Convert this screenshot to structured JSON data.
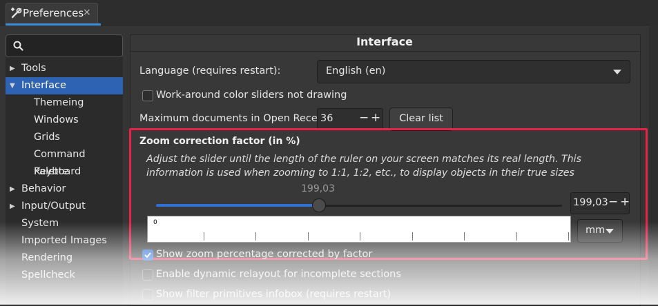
{
  "window": {
    "tab_label": "Preferences",
    "tab_close": "×",
    "tab_icon": "tools-icon"
  },
  "sidebar": {
    "search_placeholder": "",
    "items": [
      {
        "label": "Tools",
        "expandable": true,
        "expanded": false,
        "indent": 0
      },
      {
        "label": "Interface",
        "expandable": true,
        "expanded": true,
        "indent": 0,
        "selected": true
      },
      {
        "label": "Themeing",
        "indent": 1
      },
      {
        "label": "Windows",
        "indent": 1
      },
      {
        "label": "Grids",
        "indent": 1
      },
      {
        "label": "Command Palette",
        "indent": 1
      },
      {
        "label": "Keyboard",
        "indent": 1
      },
      {
        "label": "Behavior",
        "expandable": true,
        "expanded": false,
        "indent": 0
      },
      {
        "label": "Input/Output",
        "expandable": true,
        "expanded": false,
        "indent": 0
      },
      {
        "label": "System",
        "indent": 0
      },
      {
        "label": "Imported Images",
        "indent": 0
      },
      {
        "label": "Rendering",
        "indent": 0
      },
      {
        "label": "Spellcheck",
        "indent": 0
      }
    ]
  },
  "main": {
    "title": "Interface",
    "language_label": "Language (requires restart):",
    "language_value": "English (en)",
    "workaround_label": "Work-around color sliders not drawing",
    "workaround_checked": false,
    "max_docs_label": "Maximum documents in Open Recent:",
    "max_docs_value": "36",
    "minus": "−",
    "plus": "+",
    "clear_list_label": "Clear list",
    "zoom": {
      "title": "Zoom correction factor (in %)",
      "description": "Adjust the slider until the length of the ruler on your screen matches its real length. This information is used when zooming to 1:1, 1:2, etc., to display objects in their true sizes",
      "slider_value_label": "199,03",
      "slider_fraction": 0.4,
      "spin_value": "199,03",
      "ruler_zero": "0",
      "unit": "mm"
    },
    "show_zoom_label": "Show zoom percentage corrected by factor",
    "show_zoom_checked": true,
    "dynamic_relayout_label": "Enable dynamic relayout for incomplete sections",
    "dynamic_relayout_checked": false,
    "filter_infobox_label": "Show filter primitives infobox (requires restart)",
    "filter_infobox_checked": false
  },
  "colors": {
    "accent": "#2f6fd6",
    "selection": "#2d63b2",
    "highlight_box": "#e8234a",
    "background": "#353535"
  }
}
